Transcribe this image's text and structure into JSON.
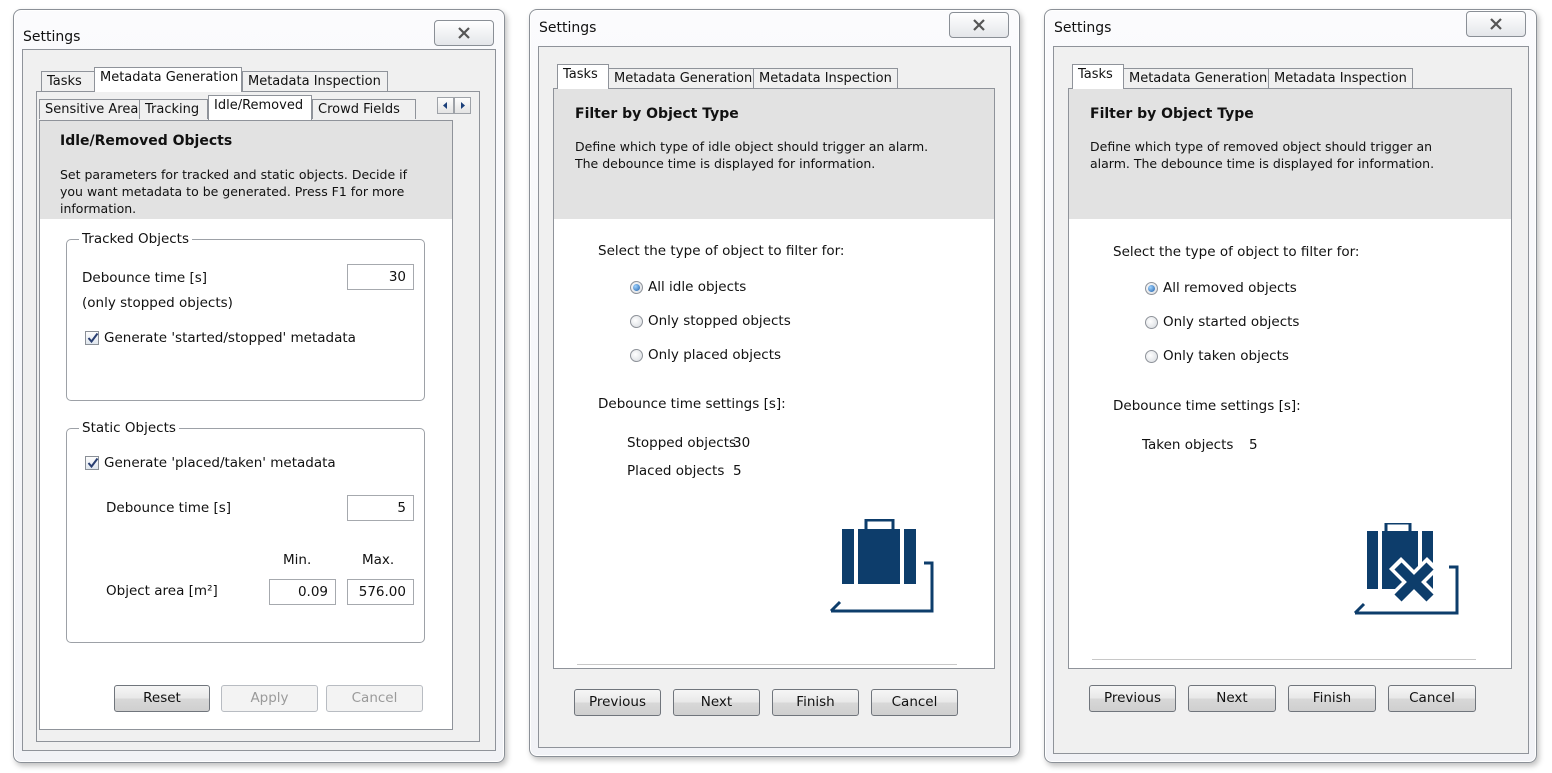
{
  "dialog1": {
    "title": "Settings",
    "top_tabs": [
      "Tasks",
      "Metadata Generation",
      "Metadata Inspection"
    ],
    "sub_tabs": [
      "Sensitive Area",
      "Tracking",
      "Idle/Removed",
      "Crowd Fields"
    ],
    "header_title": "Idle/Removed Objects",
    "header_desc": "Set parameters for tracked and static objects. Decide if you want metadata to be generated. Press F1 for more information.",
    "tracked": {
      "legend": "Tracked Objects",
      "debounce_label": "Debounce time [s]",
      "debounce_value": "30",
      "note": "(only stopped objects)",
      "checkbox_label": "Generate 'started/stopped' metadata",
      "checked": true
    },
    "static": {
      "legend": "Static Objects",
      "checkbox_label": "Generate 'placed/taken' metadata",
      "checked": true,
      "debounce_label": "Debounce time [s]",
      "debounce_value": "5",
      "min_label": "Min.",
      "max_label": "Max.",
      "area_label": "Object area [m²]",
      "area_min": "0.09",
      "area_max": "576.00"
    },
    "buttons": {
      "reset": "Reset",
      "apply": "Apply",
      "cancel": "Cancel"
    }
  },
  "dialog2": {
    "title": "Settings",
    "tabs": [
      "Tasks",
      "Metadata Generation",
      "Metadata Inspection"
    ],
    "header_title": "Filter by Object Type",
    "header_desc": "Define which type of idle object should trigger an alarm. The debounce time is displayed for information.",
    "prompt": "Select the type of object to filter for:",
    "options": [
      "All idle objects",
      "Only stopped objects",
      "Only placed objects"
    ],
    "selected_index": 0,
    "debounce_heading": "Debounce time settings [s]:",
    "debounce_rows": [
      {
        "label": "Stopped objects",
        "value": "30"
      },
      {
        "label": "Placed objects",
        "value": "5"
      }
    ],
    "icon": "idle-luggage-icon",
    "buttons": {
      "previous": "Previous",
      "next": "Next",
      "finish": "Finish",
      "cancel": "Cancel"
    }
  },
  "dialog3": {
    "title": "Settings",
    "tabs": [
      "Tasks",
      "Metadata Generation",
      "Metadata Inspection"
    ],
    "header_title": "Filter by Object Type",
    "header_desc": "Define which type of removed object should trigger an alarm. The debounce time is displayed for information.",
    "prompt": "Select the type of object to filter for:",
    "options": [
      "All removed objects",
      "Only started objects",
      "Only taken objects"
    ],
    "selected_index": 0,
    "debounce_heading": "Debounce time settings [s]:",
    "debounce_rows": [
      {
        "label": "Taken objects",
        "value": "5"
      }
    ],
    "icon": "removed-luggage-icon",
    "buttons": {
      "previous": "Previous",
      "next": "Next",
      "finish": "Finish",
      "cancel": "Cancel"
    }
  },
  "colors": {
    "icon_blue": "#0d3d6b",
    "header_gray": "#e2e2e2",
    "radio_blue": "#1f5ea8"
  }
}
